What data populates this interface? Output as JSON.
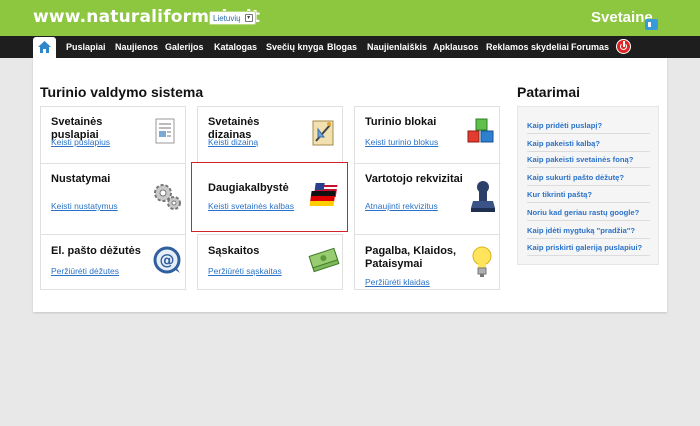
{
  "header": {
    "site_title": "www.naturaliformule.lt",
    "language": "Lietuvių",
    "brand": "Svetaine"
  },
  "nav": {
    "items": [
      "Puslapiai",
      "Naujienos",
      "Galerijos",
      "Katalogas",
      "Svečių knyga",
      "Blogas",
      "Naujienlaiškis",
      "Apklausos",
      "Reklamos skydeliai",
      "Forumas"
    ]
  },
  "main": {
    "title": "Turinio valdymo sistema",
    "cards": [
      {
        "title": "Svetainės puslapiai",
        "link": "Keisti puslapius",
        "icon": "pages-icon"
      },
      {
        "title": "Svetainės dizainas",
        "link": "Keisti dizainą",
        "icon": "design-icon"
      },
      {
        "title": "Turinio blokai",
        "link": "Keisti turinio blokus",
        "icon": "blocks-icon"
      },
      {
        "title": "Nustatymai",
        "link": "Keisti nustatymus",
        "icon": "gears-icon"
      },
      {
        "title": "Daugiakalbystė",
        "link": "Keisti svetainės kalbas",
        "icon": "flags-icon"
      },
      {
        "title": "Vartotojo rekvizitai",
        "link": "Atnaujinti rekvizitus",
        "icon": "stamp-icon"
      },
      {
        "title": "El. pašto dėžutės",
        "link": "Peržiūrėti dėžutes",
        "icon": "mail-icon"
      },
      {
        "title": "Sąskaitos",
        "link": "Peržiūrėti sąskaitas",
        "icon": "money-icon"
      },
      {
        "title": "Pagalba, Klaidos, Pataisymai",
        "link": "Peržiūrėti klaidas",
        "icon": "bulb-icon"
      }
    ]
  },
  "sidebar": {
    "title": "Patarimai",
    "tips": [
      "Kaip pridėti puslapį?",
      "Kaip pakeisti kalbą?",
      "Kaip pakeisti svetainės foną?",
      "Kaip sukurti pašto dėžutę?",
      "Kur tikrinti paštą?",
      "Noriu kad geriau rastų google?",
      "Kaip įdėti mygtuką \"pradžia\"?",
      "Kaip priskirti galeriją puslapiui?"
    ]
  },
  "colors": {
    "header_green": "#8dc63f",
    "nav_dark": "#1e1e1e",
    "link_blue": "#2a72c8",
    "highlight_red": "#d2232a"
  }
}
